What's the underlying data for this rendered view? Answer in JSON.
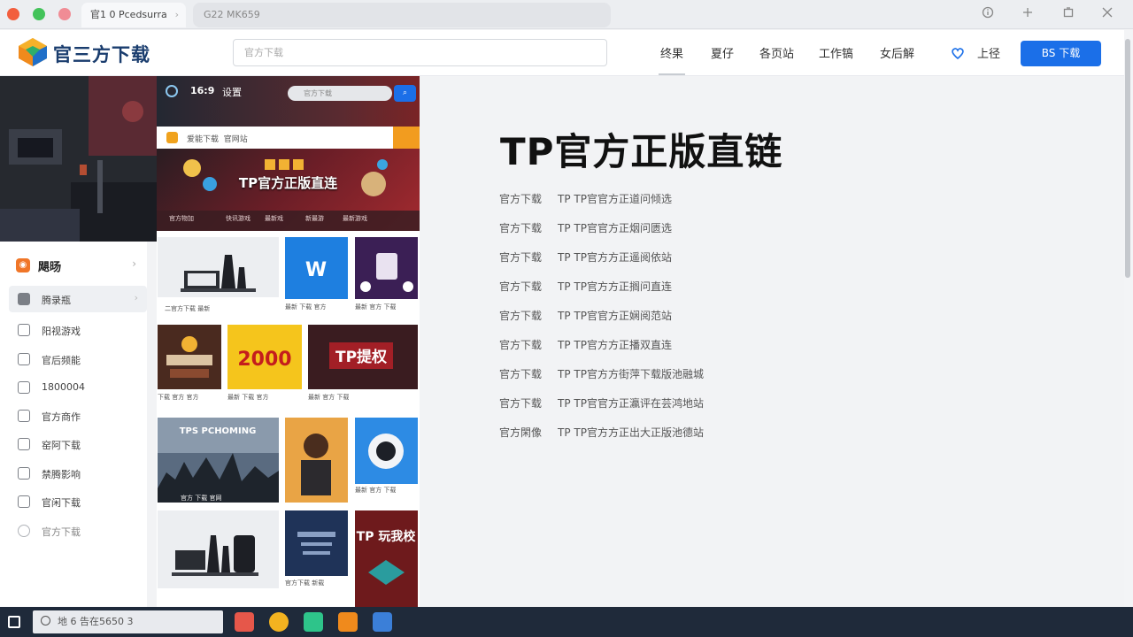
{
  "window": {
    "tab_title": "官1 0 Pcedsurra",
    "address": "G22 MK659"
  },
  "header": {
    "logo_text": "官三方下载",
    "search_placeholder": "官方下载",
    "nav": [
      "终果",
      "夏仔",
      "各页站",
      "工作镐",
      "女后解"
    ],
    "login_label": "上径",
    "download_button": "BS 下载"
  },
  "sidebar": {
    "heading": "飓旸",
    "items": [
      {
        "label": "腾录瓶",
        "icon": "chat-icon"
      },
      {
        "label": "阳视游戏",
        "icon": "game-icon"
      },
      {
        "label": "官后频能",
        "icon": "video-icon"
      },
      {
        "label": "1800004",
        "icon": "grid-icon"
      },
      {
        "label": "官方商作",
        "icon": "shop-icon"
      },
      {
        "label": "窑阿下载",
        "icon": "download-icon"
      },
      {
        "label": "禁腾影响",
        "icon": "film-icon"
      },
      {
        "label": "官闲下载",
        "icon": "edit-icon"
      },
      {
        "label": "官方下载",
        "icon": "user-icon"
      }
    ]
  },
  "phone": {
    "time": "16:9",
    "top_label": "设置",
    "search_placeholder": "官方下载",
    "bar_title": "爱能下载",
    "bar_sub": "官网站",
    "banner_title": "TP官方正版直连",
    "banner_cats": [
      "官方物加",
      "快讯游戏",
      "最新戏",
      "新最游",
      "最新游戏"
    ],
    "tiles": [
      {
        "caption": "二官方下载 最新"
      },
      {
        "caption": "最新 下载 官方"
      },
      {
        "caption": "最新 官方 下载"
      },
      {
        "caption": "下载 官方 官方"
      },
      {
        "caption": "2000",
        "sub": "最新 下载 官方"
      },
      {
        "caption": "TP提权",
        "sub": "最新 官方 下载"
      },
      {
        "caption": "TPS PCHOMING",
        "sub": "官方 下载 官网"
      },
      {
        "caption": ""
      },
      {
        "caption": "最新 官方 下载"
      },
      {
        "caption": ""
      },
      {
        "caption": "官方下载 新载"
      },
      {
        "caption": "TP 玩我校",
        "sub": ""
      }
    ]
  },
  "main": {
    "title": "TP官方正版直链",
    "links": [
      {
        "key": "官方下载",
        "value": "TP TP官官方正道问倾选"
      },
      {
        "key": "官方下载",
        "value": "TP TP官官方正烟问匮选"
      },
      {
        "key": "官方下载",
        "value": "TP TP官方方正遥阅依站"
      },
      {
        "key": "官方下载",
        "value": "TP TP官方方正搁问直连"
      },
      {
        "key": "官方下载",
        "value": "TP TP官官方正娴阅范站"
      },
      {
        "key": "官方下载",
        "value": "TP TP官方方正播双直连"
      },
      {
        "key": "官方下载",
        "value": "TP TP官方方街萍下载版池融城"
      },
      {
        "key": "官方下载",
        "value": "TP TP官官方正瀛评在芸鸿地站"
      },
      {
        "key": "官方閑像",
        "value": "TP TP官方方正出大正版池德站"
      }
    ]
  },
  "taskbar": {
    "search_text": "地 6 告在5650 3"
  }
}
